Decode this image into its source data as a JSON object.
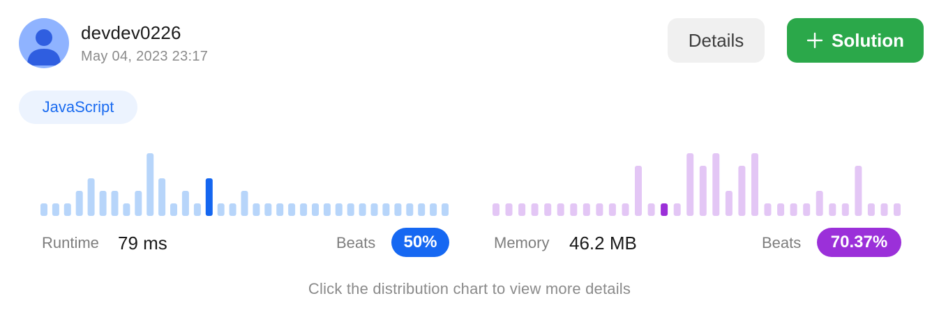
{
  "user": {
    "username": "devdev0226",
    "timestamp": "May 04, 2023 23:17"
  },
  "actions": {
    "details_label": "Details",
    "solution_label": "Solution"
  },
  "language": "JavaScript",
  "runtime": {
    "label": "Runtime",
    "value": "79 ms",
    "beats_label": "Beats",
    "beats_value": "50%"
  },
  "memory": {
    "label": "Memory",
    "value": "46.2 MB",
    "beats_label": "Beats",
    "beats_value": "70.37%"
  },
  "hint": "Click the distribution chart to view more details",
  "colors": {
    "runtime_bar": "#b7d5fa",
    "runtime_highlight": "#1466f0",
    "memory_bar": "#e3c6f5",
    "memory_highlight": "#9b2fd8",
    "solution_green": "#2ba84a",
    "avatar_bg": "#8fb3ff",
    "avatar_fg": "#2f5ee0"
  },
  "chart_data": [
    {
      "type": "bar",
      "name": "runtime-distribution",
      "values": [
        1,
        1,
        1,
        2,
        3,
        2,
        2,
        1,
        2,
        5,
        3,
        1,
        2,
        1,
        3,
        1,
        1,
        2,
        1,
        1,
        1,
        1,
        1,
        1,
        1,
        1,
        1,
        1,
        1,
        1,
        1,
        1,
        1,
        1,
        1
      ],
      "highlight_index": 14
    },
    {
      "type": "bar",
      "name": "memory-distribution",
      "values": [
        1,
        1,
        1,
        1,
        1,
        1,
        1,
        1,
        1,
        1,
        1,
        4,
        1,
        1,
        1,
        5,
        4,
        5,
        2,
        4,
        5,
        1,
        1,
        1,
        1,
        2,
        1,
        1,
        4,
        1,
        1,
        1
      ],
      "highlight_index": 13
    }
  ]
}
